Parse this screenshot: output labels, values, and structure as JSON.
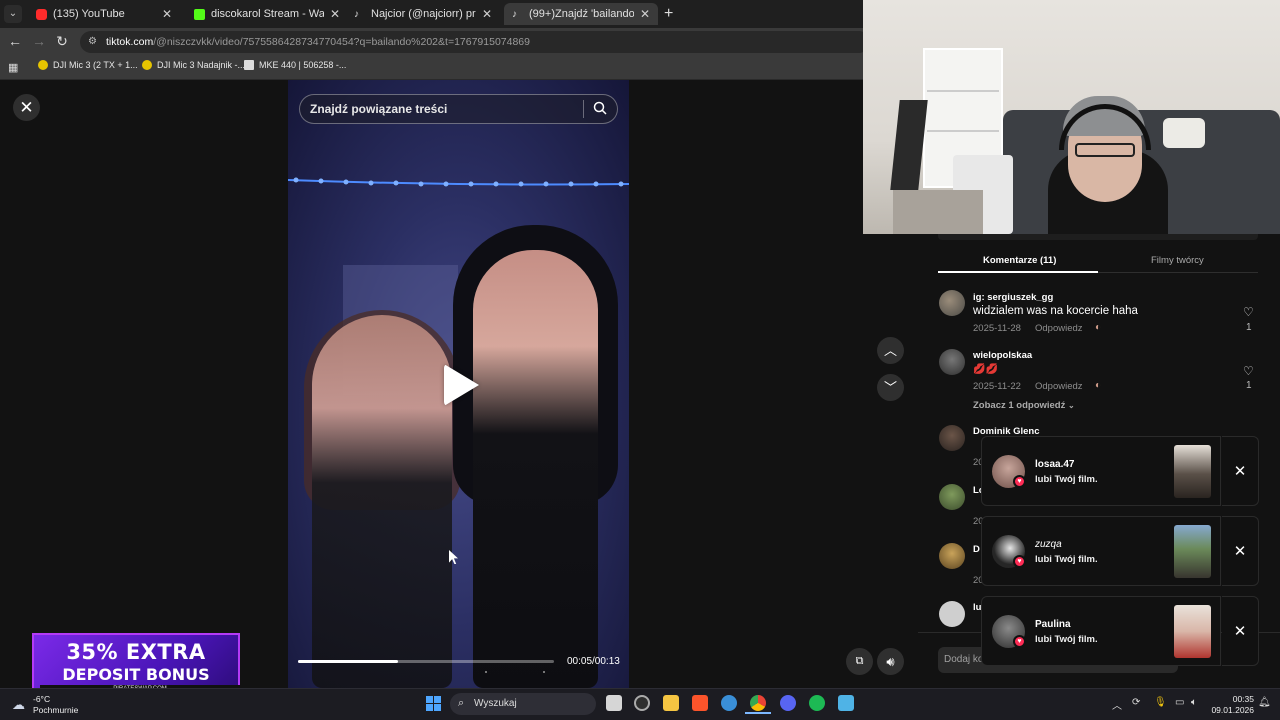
{
  "browser": {
    "tabs": [
      {
        "title": "(135) YouTube",
        "favicon": "youtube-icon",
        "color": "#ff2b2b"
      },
      {
        "title": "discokarol Stream - Watch Live",
        "favicon": "kick-icon",
        "color": "#53fc18"
      },
      {
        "title": "Najcior (@najciorr) prowadzi LIVE",
        "favicon": "tiktok-icon",
        "color": "#ffffff"
      },
      {
        "title": "(99+)Znajdź 'bailando 2' na TikTok",
        "favicon": "tiktok-icon",
        "color": "#ffffff",
        "active": true
      }
    ],
    "url_host": "tiktok.com",
    "url_path": "/@niszczvkk/video/7575586428734770454?q=bailando%202&t=1767915074869",
    "bookmarks": [
      "DJI Mic 3 (2 TX + 1...",
      "DJI Mic 3 Nadajnik -...",
      "MKE 440 | 506258 -..."
    ]
  },
  "video": {
    "search_placeholder": "Znajdź powiązane treści",
    "time": "00:05/00:13",
    "progress": 0.39
  },
  "comments_panel": {
    "tab_comments": "Komentarze (11)",
    "tab_creator": "Filmy twórcy",
    "comments": [
      {
        "user": "ig: sergiuszek_gg",
        "text": "widzialem was na kocercie haha",
        "date": "2025-11-28",
        "reply": "Odpowiedz",
        "likes": "1"
      },
      {
        "user": "wielopolskaa",
        "text": "💋💋",
        "date": "2025-11-22",
        "reply": "Odpowiedz",
        "likes": "1",
        "view_replies": "Zobacz 1 odpowiedź"
      },
      {
        "user": "Dominik Glenc",
        "date_partial": "20"
      },
      {
        "user": "Lo",
        "date_partial": "20"
      },
      {
        "user": "D",
        "date_partial": "20"
      },
      {
        "user": "lu"
      }
    ],
    "add_comment": "Dodaj ko"
  },
  "notifications": [
    {
      "name": "losaa.47",
      "text": "lubi Twój film."
    },
    {
      "name": "zuzqa",
      "text": "lubi Twój film."
    },
    {
      "name": "Paulina",
      "text": "lubi Twój film."
    }
  ],
  "ad": {
    "line1": "35% EXTRA",
    "line2": "DEPOSIT BONUS",
    "footer": "PIRATESWAP.COM"
  },
  "taskbar": {
    "weather_temp": "-6°C",
    "weather_text": "Pochmurnie",
    "search": "Wyszukaj",
    "time": "00:35",
    "date": "09.01.2026"
  },
  "colors": {
    "tiktok_red": "#fe2c55",
    "ad_purple": "#7b2ae8"
  }
}
